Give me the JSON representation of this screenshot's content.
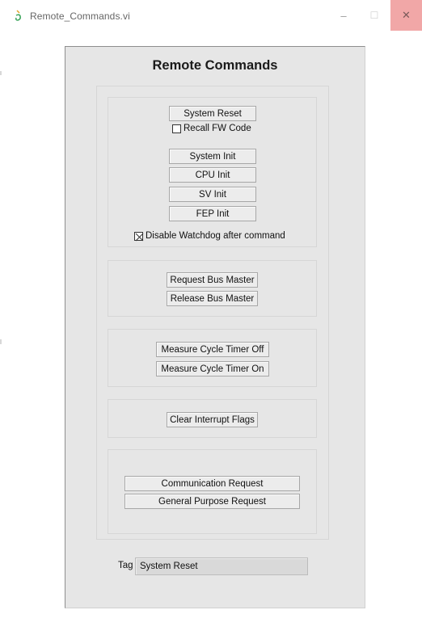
{
  "window": {
    "title": "Remote_Commands.vi",
    "controls": {
      "minimize": "–",
      "maximize": "☐",
      "close": "✕"
    }
  },
  "panel": {
    "title": "Remote Commands",
    "reset_group": {
      "system_reset": "System Reset",
      "recall_fw_code": {
        "label": "Recall FW Code",
        "checked": false
      },
      "system_init": "System Init",
      "cpu_init": "CPU Init",
      "sv_init": "SV Init",
      "fep_init": "FEP Init",
      "disable_watchdog": {
        "label": "Disable Watchdog after command",
        "checked": true
      }
    },
    "bus_group": {
      "request_bus_master": "Request Bus Master",
      "release_bus_master": "Release Bus Master"
    },
    "timer_group": {
      "cycle_timer_off": "Measure Cycle Timer Off",
      "cycle_timer_on": "Measure Cycle Timer On"
    },
    "interrupt_group": {
      "clear_interrupt_flags": "Clear Interrupt Flags"
    },
    "request_group": {
      "communication_request": "Communication Request",
      "general_purpose_request": "General Purpose Request"
    },
    "tag": {
      "label": "Tag",
      "value": "System Reset"
    }
  },
  "colors": {
    "panel_bg": "#e6e6e6",
    "close_button_bg": "#f1a7a7"
  }
}
